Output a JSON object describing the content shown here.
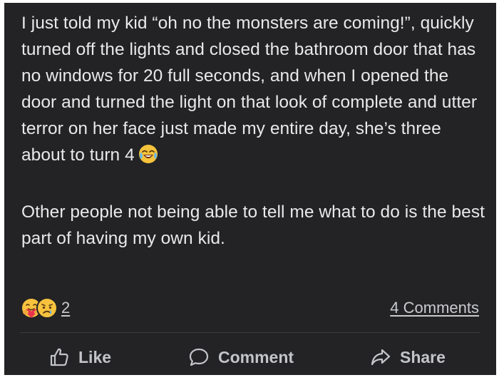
{
  "post": {
    "paragraphs": [
      "I just told my kid “oh no the monsters are coming!”, quickly turned off the lights and closed the bathroom door that has no windows for 20 full seconds, and when I opened the door and turned the light on that look of complete and utter terror on her face just made my entire day, she’s three about to turn 4",
      "Other people not being able to tell me what to do is the best part of having my own kid."
    ],
    "inline_emoji": "laughing-crying-emoji"
  },
  "reactions": {
    "icons": [
      "hug-reaction-icon",
      "sad-reaction-icon"
    ],
    "count": "2"
  },
  "comments_link": "4 Comments",
  "actions": {
    "like": "Like",
    "comment": "Comment",
    "share": "Share"
  },
  "colors": {
    "background": "#232325",
    "text": "#e9e9ea",
    "muted": "#c9cacd",
    "divider": "#3a3b3e"
  }
}
